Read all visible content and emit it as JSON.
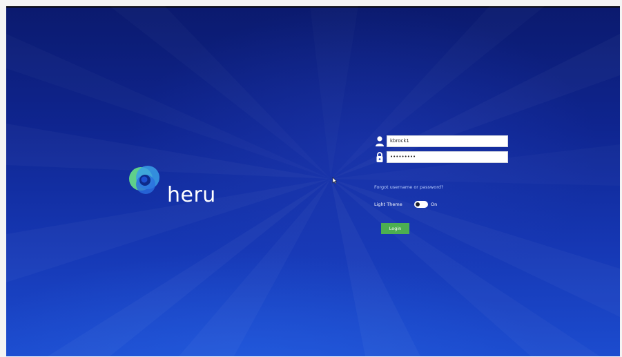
{
  "app": {
    "logo_text": "heru"
  },
  "login": {
    "username_value": "kbrock1",
    "username_icon": "user-icon",
    "password_value": "•••••••••",
    "password_icon": "lock-icon",
    "forgot_link": "Forgot username or password?",
    "theme_label": "Light Theme",
    "theme_state": "On",
    "theme_enabled": true,
    "submit_label": "Login"
  },
  "colors": {
    "background_top": "#0b1a6e",
    "background_bottom": "#1c4ccf",
    "login_button": "#4caf50",
    "link": "#bcd0ff",
    "logo_green": "#5fd08a",
    "logo_blue": "#3aa0e8"
  }
}
